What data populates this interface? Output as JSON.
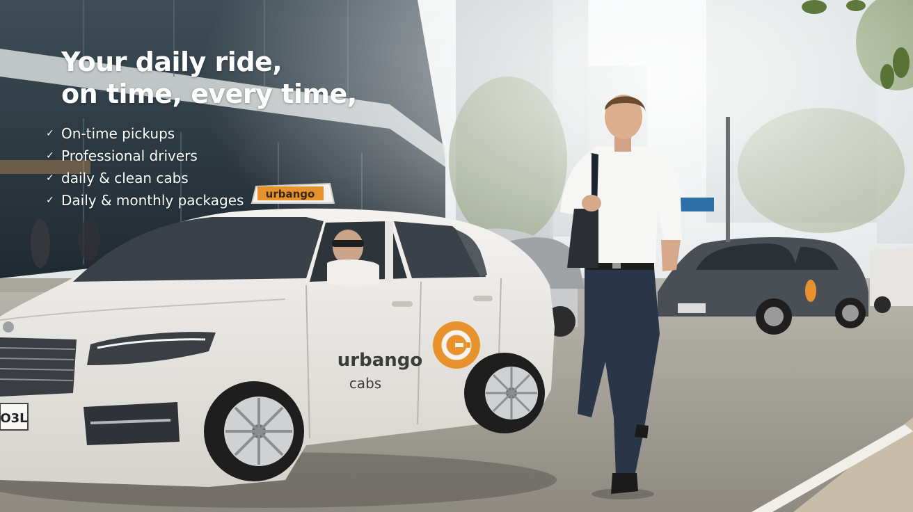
{
  "hero": {
    "headline_line1": "Your daily ride,",
    "headline_line2": "on time, every time,"
  },
  "features": [
    {
      "icon": "check-icon",
      "label": "On-time pickups"
    },
    {
      "icon": "check-icon",
      "label": "Professional drivers"
    },
    {
      "icon": "check-icon",
      "label": "daily & clean cabs"
    },
    {
      "icon": "check-icon",
      "label": "Daily & monthly packages"
    }
  ],
  "taxi": {
    "roof_sign": "urbango",
    "door_brand": "urbango",
    "door_sub": "cabs",
    "logo_letter": "G",
    "plate": "O3L"
  },
  "colors": {
    "brand_orange": "#e8922e",
    "text_white": "#ffffff",
    "car_white": "#eceae6",
    "brand_dark": "#3c3c3c"
  }
}
